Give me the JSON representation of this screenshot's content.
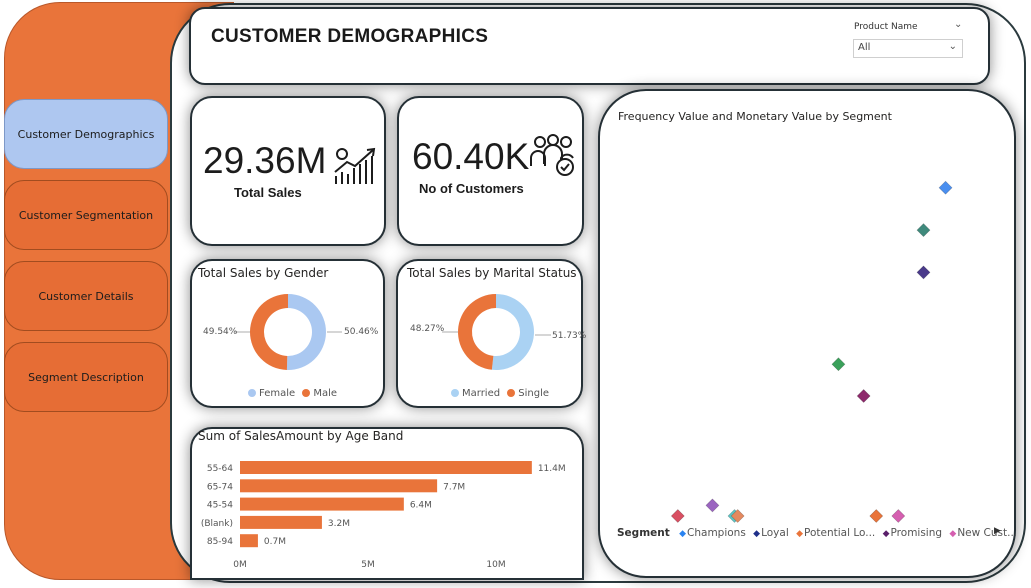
{
  "nav": {
    "items": [
      {
        "label": "Customer Demographics",
        "active": true
      },
      {
        "label": "Customer Segmentation",
        "active": false
      },
      {
        "label": "Customer Details",
        "active": false
      },
      {
        "label": "Segment Description",
        "active": false
      }
    ]
  },
  "header": {
    "title": "CUSTOMER DEMOGRAPHICS",
    "slicer_label": "Product Name",
    "slicer_value": "All"
  },
  "kpis": {
    "sales": {
      "value": "29.36M",
      "label": "Total Sales",
      "icon": "rising-chart-icon"
    },
    "customers": {
      "value": "60.40K",
      "label": "No of Customers",
      "icon": "customer-group-icon"
    }
  },
  "colors": {
    "orange": "#e9743a",
    "blue": "#aac8f1",
    "accent_active": "#aec7f0"
  },
  "chart_data": [
    {
      "type": "pie",
      "title": "Total Sales by Gender",
      "slices": [
        {
          "label": "Female",
          "value": 50.46,
          "display": "50.46%",
          "color": "#aac8f1"
        },
        {
          "label": "Male",
          "value": 49.54,
          "display": "49.54%",
          "color": "#e9743a"
        }
      ],
      "legend": "bottom"
    },
    {
      "type": "pie",
      "title": "Total Sales by Marital Status",
      "slices": [
        {
          "label": "Married",
          "value": 51.73,
          "display": "51.73%",
          "color": "#aad2f3"
        },
        {
          "label": "Single",
          "value": 48.27,
          "display": "48.27%",
          "color": "#e9743a"
        }
      ],
      "legend": "bottom"
    },
    {
      "type": "bar",
      "orientation": "horizontal",
      "title": "Sum of SalesAmount by Age Band",
      "categories": [
        "55-64",
        "65-74",
        "45-54",
        "(Blank)",
        "85-94"
      ],
      "values": [
        11.4,
        7.7,
        6.4,
        3.2,
        0.7
      ],
      "value_labels": [
        "11.4M",
        "7.7M",
        "6.4M",
        "3.2M",
        "0.7M"
      ],
      "xticks": [
        "0M",
        "5M",
        "10M"
      ],
      "xlim": [
        0,
        10
      ],
      "color": "#e9743a"
    },
    {
      "type": "scatter",
      "title": "Frequency Value and Monetary Value by Segment",
      "marker": "diamond",
      "points": [
        {
          "x": 0.97,
          "y": 0.93,
          "color": "#4a8ff0"
        },
        {
          "x": 0.9,
          "y": 0.81,
          "color": "#3f8a7c"
        },
        {
          "x": 0.9,
          "y": 0.69,
          "color": "#4a3a8a"
        },
        {
          "x": 0.63,
          "y": 0.43,
          "color": "#3aa05a"
        },
        {
          "x": 0.71,
          "y": 0.34,
          "color": "#8e2a6c"
        },
        {
          "x": 0.23,
          "y": 0.03,
          "color": "#9b65c0"
        },
        {
          "x": 0.3,
          "y": 0.0,
          "color": "#5cc6c6"
        },
        {
          "x": 0.31,
          "y": 0.0,
          "color": "#e4895f"
        },
        {
          "x": 0.12,
          "y": 0.0,
          "color": "#d94f62"
        },
        {
          "x": 0.75,
          "y": 0.0,
          "color": "#e9743a"
        },
        {
          "x": 0.82,
          "y": 0.0,
          "color": "#d55fb0"
        }
      ],
      "legend_title": "Segment",
      "legend": [
        {
          "label": "Champions",
          "color": "#2a83f0"
        },
        {
          "label": "Loyal",
          "color": "#1f2f8a"
        },
        {
          "label": "Potential Lo...",
          "color": "#e9743a"
        },
        {
          "label": "Promising",
          "color": "#5a1f6a"
        },
        {
          "label": "New Cust...",
          "color": "#d55fb0"
        }
      ]
    }
  ]
}
